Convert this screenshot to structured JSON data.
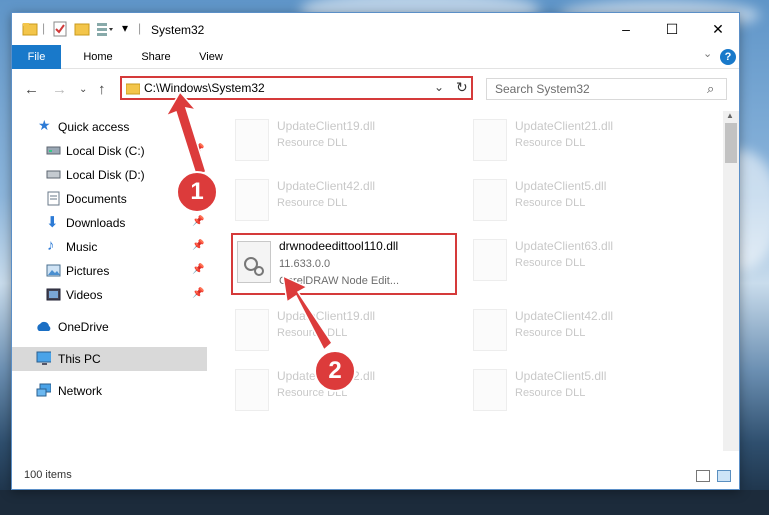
{
  "window": {
    "title": "System32",
    "controls": {
      "minimize": "–",
      "maximize": "☐",
      "close": "✕"
    }
  },
  "ribbon": {
    "tabs": [
      "File",
      "Home",
      "Share",
      "View"
    ],
    "help": "?"
  },
  "address": {
    "path": "C:\\Windows\\System32",
    "search_placeholder": "Search System32"
  },
  "sidebar": {
    "items": [
      {
        "label": "Quick access",
        "icon": "star-icon",
        "pinned": false
      },
      {
        "label": "Local Disk (C:)",
        "icon": "disk-icon",
        "pinned": true
      },
      {
        "label": "Local Disk (D:)",
        "icon": "disk-icon",
        "pinned": true
      },
      {
        "label": "Documents",
        "icon": "documents-icon",
        "pinned": true
      },
      {
        "label": "Downloads",
        "icon": "download-icon",
        "pinned": true
      },
      {
        "label": "Music",
        "icon": "music-icon",
        "pinned": true
      },
      {
        "label": "Pictures",
        "icon": "pictures-icon",
        "pinned": true
      },
      {
        "label": "Videos",
        "icon": "videos-icon",
        "pinned": true
      },
      {
        "label": "OneDrive",
        "icon": "cloud-icon",
        "pinned": false
      },
      {
        "label": "This PC",
        "icon": "computer-icon",
        "pinned": false,
        "selected": true
      },
      {
        "label": "Network",
        "icon": "network-icon",
        "pinned": false
      }
    ]
  },
  "files": {
    "highlighted": {
      "name": "drwnodeedittool110.dll",
      "version": "11.633.0.0",
      "description": "CorelDRAW Node Edit..."
    },
    "left_column": [
      {
        "name": "UpdateClient19.dll",
        "type": "Resource DLL"
      },
      {
        "name": "UpdateClient42.dll",
        "type": "Resource DLL"
      },
      {
        "name": "UpdateClient19.dll",
        "type": "Resource DLL"
      },
      {
        "name": "UpdateClient42.dll",
        "type": "Resource DLL"
      }
    ],
    "right_column": [
      {
        "name": "UpdateClient21.dll",
        "type": "Resource DLL"
      },
      {
        "name": "UpdateClient5.dll",
        "type": "Resource DLL"
      },
      {
        "name": "UpdateClient63.dll",
        "type": "Resource DLL"
      },
      {
        "name": "UpdateClient42.dll",
        "type": "Resource DLL"
      },
      {
        "name": "UpdateClient5.dll",
        "type": "Resource DLL"
      }
    ]
  },
  "status": {
    "count": "100 items"
  },
  "annotations": {
    "step1": "1",
    "step2": "2"
  },
  "colors": {
    "accent": "#1979ca",
    "highlight": "#d53a3a",
    "badge": "#dc3b3b"
  }
}
